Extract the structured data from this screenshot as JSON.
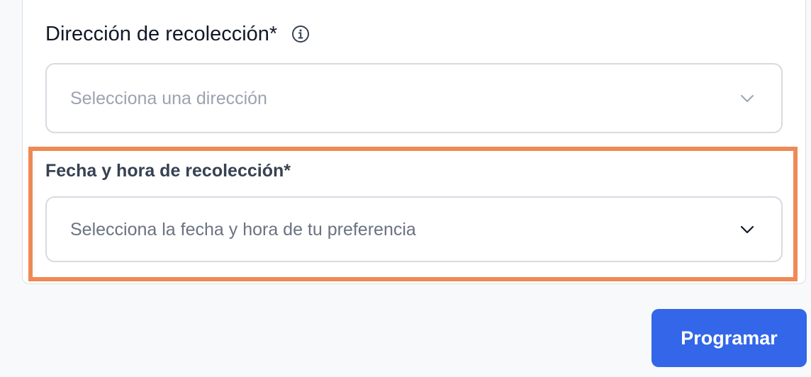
{
  "form": {
    "pickup_address": {
      "label": "Dirección de recolección*",
      "placeholder": "Selecciona una dirección",
      "info_icon": "info-circle-icon",
      "dropdown_icon": "chevron-down-icon"
    },
    "pickup_datetime": {
      "label": "Fecha y hora de recolección*",
      "placeholder": "Selecciona la fecha y hora de tu preferencia",
      "dropdown_icon": "chevron-down-icon"
    }
  },
  "actions": {
    "schedule_label": "Programar"
  },
  "colors": {
    "accent": "#3366E8",
    "highlight": "#EF8A55",
    "border": "#D7DBE0",
    "page_background": "#F8F9FB"
  }
}
